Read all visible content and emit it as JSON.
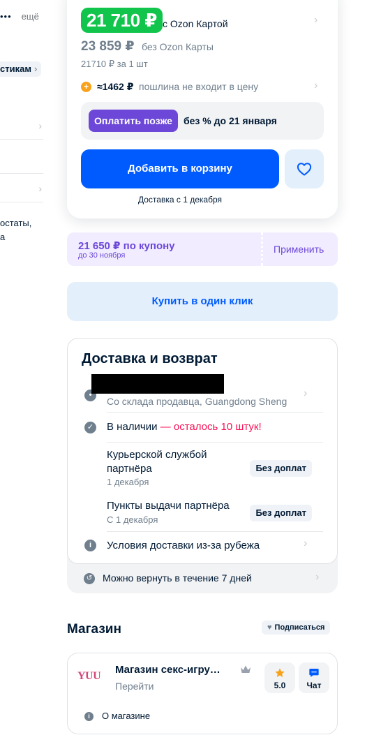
{
  "left_column": {
    "more_dots": "•••",
    "more_label": "ещё",
    "chip_label": "стикам",
    "text_line1": "остаты,",
    "text_line2": "а"
  },
  "price_card": {
    "ozon_price": "21 710 ₽",
    "ozon_label": "с Ozon Картой",
    "old_price": "23 859 ₽",
    "old_label": "без Ozon Карты",
    "per_unit": "21710 ₽ за 1 шт",
    "duty_value": "≈1462 ₽",
    "duty_text": "пошлина не входит в цену",
    "pay_later_button": "Оплатить позже",
    "pay_later_text": "без % до 21 января",
    "add_to_cart": "Добавить в корзину",
    "delivery_hint": "Доставка с 1 декабря"
  },
  "coupon": {
    "price": "21 650 ₽ по купону",
    "until": "до 30 ноября",
    "apply": "Применить"
  },
  "one_click": "Купить в один клик",
  "delivery": {
    "title": "Доставка и возврат",
    "warehouse": "Со склада продавца, Guangdong Sheng",
    "in_stock": "В наличии",
    "stock_left": " — осталось 10 штук!",
    "courier_line1": "Курьерской службой",
    "courier_line2": "партнёра",
    "courier_date": "1 декабря",
    "courier_badge": "Без доплат",
    "pickup": "Пункты выдачи партнёра",
    "pickup_date": "С 1 декабря",
    "pickup_badge": "Без доплат",
    "abroad_conditions": "Условия доставки из-за рубежа",
    "return_text": "Можно вернуть в течение 7 дней"
  },
  "shop": {
    "title": "Магазин",
    "subscribe": "Подписаться",
    "logo_text": "YUU",
    "name": "Магазин секс-игру…",
    "go": "Перейти",
    "rating": "5.0",
    "chat": "Чат",
    "about": "О магазине"
  },
  "colors": {
    "ozon_green": "#10c44c",
    "primary_blue": "#005bff",
    "purple": "#6c47d8",
    "pink_alert": "#f91155",
    "muted_text": "#707f8d"
  }
}
